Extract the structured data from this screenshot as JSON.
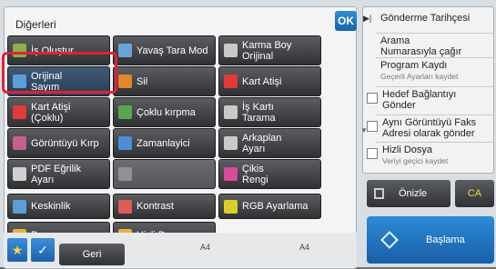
{
  "panel": {
    "title": "Diğerleri",
    "ok_label": "OK"
  },
  "buttons": [
    {
      "name": "btn-is-olustur",
      "label": "İş Oluştur",
      "icon": "job-build-icon",
      "color": "#8db04a",
      "state": "normal"
    },
    {
      "name": "btn-yavas-tara-mod",
      "label": "Yavaş Tara Mod",
      "icon": "slow-scan-icon",
      "color": "#6aa5d6",
      "state": "normal"
    },
    {
      "name": "btn-karma-boy-orijinal",
      "label": "Karma Boy\nOrijinal",
      "icon": "mixed-size-icon",
      "color": "#c9c9c9",
      "state": "normal"
    },
    {
      "name": "btn-orijinal-sayim",
      "label": "Orijinal\nSayım",
      "icon": "original-count-icon",
      "color": "#5b9fd8",
      "state": "selected"
    },
    {
      "name": "btn-sil",
      "label": "Sil",
      "icon": "erase-icon",
      "color": "#e4862d",
      "state": "normal"
    },
    {
      "name": "btn-kart-atisi",
      "label": "Kart Atişi",
      "icon": "card-shot-icon",
      "color": "#e03b3b",
      "state": "normal"
    },
    {
      "name": "btn-kart-atisi-coklu",
      "label": "Kart Atişi\n(Çoklu)",
      "icon": "card-shot-multi-icon",
      "color": "#e03b3b",
      "state": "normal"
    },
    {
      "name": "btn-coklu-kirpma",
      "label": "Çoklu kırpma",
      "icon": "multi-crop-icon",
      "color": "#5aa650",
      "state": "normal"
    },
    {
      "name": "btn-is-karti-tarama",
      "label": "İş Kartı\nTarama",
      "icon": "business-card-icon",
      "color": "#c9c9c9",
      "state": "normal"
    },
    {
      "name": "btn-goruntuyu-kirp",
      "label": "Görüntüyü Kırp",
      "icon": "image-crop-icon",
      "color": "#c4608f",
      "state": "normal"
    },
    {
      "name": "btn-zamanlayici",
      "label": "Zamanlayici",
      "icon": "timer-icon",
      "color": "#4a8fd4",
      "state": "normal"
    },
    {
      "name": "btn-arkaplan-ayari",
      "label": "Arkaplan\nAyarı",
      "icon": "background-icon",
      "color": "#c9c9c9",
      "state": "normal"
    },
    {
      "name": "btn-pdf-egrilik-ayari",
      "label": "PDF Eğrilik\nAyarı",
      "icon": "pdf-skew-icon",
      "color": "#d0d0d0",
      "state": "normal"
    },
    {
      "name": "btn-disabled-slot",
      "label": "",
      "icon": "disabled-icon",
      "color": "#8f9194",
      "state": "disabled"
    },
    {
      "name": "btn-cikis-rengi",
      "label": "Çikis\nRengi",
      "icon": "output-color-icon",
      "color": "#d94a9d",
      "state": "normal"
    },
    {
      "name": "btn-keskinlik",
      "label": "Keskinlik",
      "icon": "sharpness-icon",
      "color": "#5b9fd8",
      "state": "normal"
    },
    {
      "name": "btn-kontrast",
      "label": "Kontrast",
      "icon": "contrast-icon",
      "color": "#e05a5a",
      "state": "normal"
    },
    {
      "name": "btn-rgb-ayarlama",
      "label": "RGB Ayarlama",
      "icon": "rgb-adjust-icon",
      "color": "#d8d028",
      "state": "normal"
    },
    {
      "name": "btn-dosya",
      "label": "Dosya",
      "icon": "folder-icon",
      "color": "#e8b23a",
      "state": "normal"
    },
    {
      "name": "btn-hizli-dosya",
      "label": "Hizli Dosya",
      "icon": "quick-file-icon",
      "color": "#e8b23a",
      "state": "normal"
    }
  ],
  "bottom": {
    "geri_label": "Geri",
    "paper_left": "A4",
    "paper_right": "A4"
  },
  "history": {
    "title": "Gönderme Tarihçesi",
    "items": [
      {
        "label": "Arama\nNumarasıyla çağır",
        "sub": "",
        "checkbox": false
      },
      {
        "label": "Program Kaydı",
        "sub": "Geçerli Ayarları kaydet",
        "checkbox": false
      },
      {
        "label": "Hedef Bağlantıyı\nGönder",
        "sub": "",
        "checkbox": true
      },
      {
        "label": "Aynı Görüntüyü Faks\nAdresi olarak gönder",
        "sub": "",
        "checkbox": true
      },
      {
        "label": "Hizli Dosya",
        "sub": "Veriyi geçici kaydet",
        "checkbox": true
      }
    ]
  },
  "actions": {
    "preview_label": "Önizle",
    "ca_label": "CA",
    "start_label": "Başlama"
  }
}
